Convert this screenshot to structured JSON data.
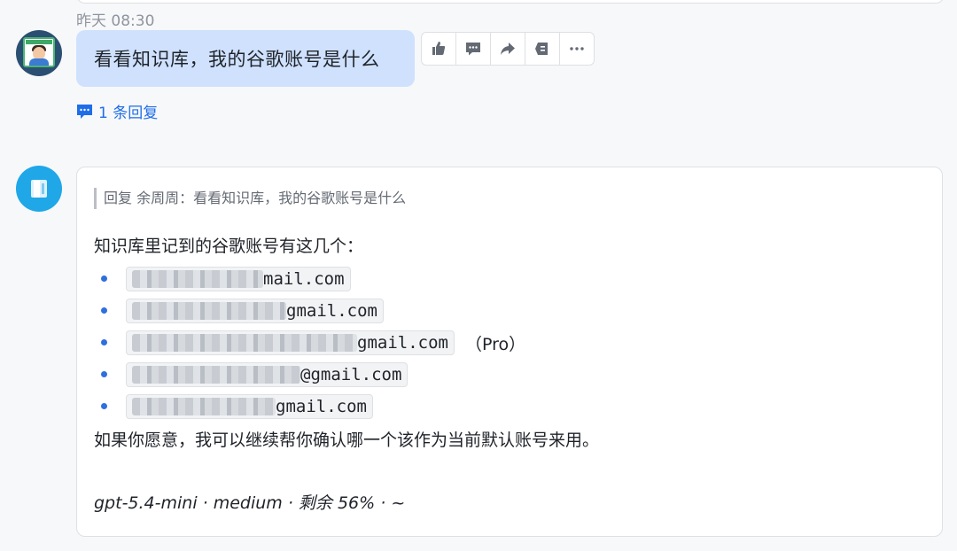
{
  "message_user": {
    "timestamp": "昨天 08:30",
    "text": "看看知识库，我的谷歌账号是什么",
    "reply_count_label": "1 条回复",
    "toolbar": [
      "thumbs-up-icon",
      "comment-icon",
      "forward-icon",
      "pin-icon",
      "more-icon"
    ]
  },
  "message_bot": {
    "quote": "回复 余周周：看看知识库，我的谷歌账号是什么",
    "intro": "知识库里记到的谷歌账号有这几个：",
    "emails": [
      {
        "suffix": "mail.com",
        "extra": ""
      },
      {
        "suffix": "gmail.com",
        "extra": ""
      },
      {
        "suffix": "gmail.com",
        "extra": "（Pro）"
      },
      {
        "suffix": "@gmail.com",
        "extra": ""
      },
      {
        "suffix": "gmail.com",
        "extra": ""
      }
    ],
    "closing": "如果你愿意，我可以继续帮你确认哪一个该作为当前默认账号来用。",
    "footer": "gpt-5.4-mini · medium · 剩余 56% · ~"
  },
  "colors": {
    "bubble": "#cfe1fd",
    "accent": "#1f6ee8",
    "bot_avatar": "#1fa7e8"
  }
}
